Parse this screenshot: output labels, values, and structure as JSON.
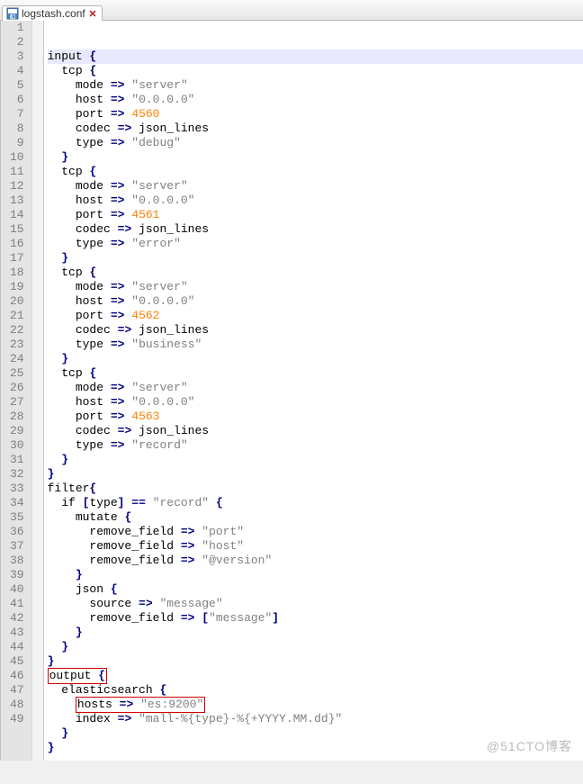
{
  "tab": {
    "filename": "logstash.conf",
    "icon": "disk-icon"
  },
  "lines": [
    {
      "n": 1,
      "indent": 0,
      "type": "open",
      "current": true,
      "tokens": [
        {
          "t": "input ",
          "c": "kw"
        },
        {
          "t": "{",
          "c": "sym"
        }
      ]
    },
    {
      "n": 2,
      "indent": 1,
      "type": "open",
      "tokens": [
        {
          "t": "tcp ",
          "c": "kw"
        },
        {
          "t": "{",
          "c": "sym"
        }
      ]
    },
    {
      "n": 3,
      "indent": 2,
      "tokens": [
        {
          "t": "mode ",
          "c": "kw"
        },
        {
          "t": "=>",
          "c": "sym"
        },
        {
          "t": " ",
          "c": "kw"
        },
        {
          "t": "\"server\"",
          "c": "str"
        }
      ]
    },
    {
      "n": 4,
      "indent": 2,
      "tokens": [
        {
          "t": "host ",
          "c": "kw"
        },
        {
          "t": "=>",
          "c": "sym"
        },
        {
          "t": " ",
          "c": "kw"
        },
        {
          "t": "\"0.0.0.0\"",
          "c": "str"
        }
      ]
    },
    {
      "n": 5,
      "indent": 2,
      "tokens": [
        {
          "t": "port ",
          "c": "kw"
        },
        {
          "t": "=>",
          "c": "sym"
        },
        {
          "t": " ",
          "c": "kw"
        },
        {
          "t": "4560",
          "c": "num"
        }
      ]
    },
    {
      "n": 6,
      "indent": 2,
      "tokens": [
        {
          "t": "codec ",
          "c": "kw"
        },
        {
          "t": "=>",
          "c": "sym"
        },
        {
          "t": " json_lines",
          "c": "kw"
        }
      ]
    },
    {
      "n": 7,
      "indent": 2,
      "tokens": [
        {
          "t": "type ",
          "c": "kw"
        },
        {
          "t": "=>",
          "c": "sym"
        },
        {
          "t": " ",
          "c": "kw"
        },
        {
          "t": "\"debug\"",
          "c": "str"
        }
      ]
    },
    {
      "n": 8,
      "indent": 1,
      "type": "close",
      "tokens": [
        {
          "t": "}",
          "c": "sym"
        }
      ]
    },
    {
      "n": 9,
      "indent": 1,
      "type": "open",
      "tokens": [
        {
          "t": "tcp ",
          "c": "kw"
        },
        {
          "t": "{",
          "c": "sym"
        }
      ]
    },
    {
      "n": 10,
      "indent": 2,
      "tokens": [
        {
          "t": "mode ",
          "c": "kw"
        },
        {
          "t": "=>",
          "c": "sym"
        },
        {
          "t": " ",
          "c": "kw"
        },
        {
          "t": "\"server\"",
          "c": "str"
        }
      ]
    },
    {
      "n": 11,
      "indent": 2,
      "tokens": [
        {
          "t": "host ",
          "c": "kw"
        },
        {
          "t": "=>",
          "c": "sym"
        },
        {
          "t": " ",
          "c": "kw"
        },
        {
          "t": "\"0.0.0.0\"",
          "c": "str"
        }
      ]
    },
    {
      "n": 12,
      "indent": 2,
      "tokens": [
        {
          "t": "port ",
          "c": "kw"
        },
        {
          "t": "=>",
          "c": "sym"
        },
        {
          "t": " ",
          "c": "kw"
        },
        {
          "t": "4561",
          "c": "num"
        }
      ]
    },
    {
      "n": 13,
      "indent": 2,
      "tokens": [
        {
          "t": "codec ",
          "c": "kw"
        },
        {
          "t": "=>",
          "c": "sym"
        },
        {
          "t": " json_lines",
          "c": "kw"
        }
      ]
    },
    {
      "n": 14,
      "indent": 2,
      "tokens": [
        {
          "t": "type ",
          "c": "kw"
        },
        {
          "t": "=>",
          "c": "sym"
        },
        {
          "t": " ",
          "c": "kw"
        },
        {
          "t": "\"error\"",
          "c": "str"
        }
      ]
    },
    {
      "n": 15,
      "indent": 1,
      "type": "close",
      "tokens": [
        {
          "t": "}",
          "c": "sym"
        }
      ]
    },
    {
      "n": 16,
      "indent": 1,
      "type": "open",
      "tokens": [
        {
          "t": "tcp ",
          "c": "kw"
        },
        {
          "t": "{",
          "c": "sym"
        }
      ]
    },
    {
      "n": 17,
      "indent": 2,
      "tokens": [
        {
          "t": "mode ",
          "c": "kw"
        },
        {
          "t": "=>",
          "c": "sym"
        },
        {
          "t": " ",
          "c": "kw"
        },
        {
          "t": "\"server\"",
          "c": "str"
        }
      ]
    },
    {
      "n": 18,
      "indent": 2,
      "tokens": [
        {
          "t": "host ",
          "c": "kw"
        },
        {
          "t": "=>",
          "c": "sym"
        },
        {
          "t": " ",
          "c": "kw"
        },
        {
          "t": "\"0.0.0.0\"",
          "c": "str"
        }
      ]
    },
    {
      "n": 19,
      "indent": 2,
      "tokens": [
        {
          "t": "port ",
          "c": "kw"
        },
        {
          "t": "=>",
          "c": "sym"
        },
        {
          "t": " ",
          "c": "kw"
        },
        {
          "t": "4562",
          "c": "num"
        }
      ]
    },
    {
      "n": 20,
      "indent": 2,
      "tokens": [
        {
          "t": "codec ",
          "c": "kw"
        },
        {
          "t": "=>",
          "c": "sym"
        },
        {
          "t": " json_lines",
          "c": "kw"
        }
      ]
    },
    {
      "n": 21,
      "indent": 2,
      "tokens": [
        {
          "t": "type ",
          "c": "kw"
        },
        {
          "t": "=>",
          "c": "sym"
        },
        {
          "t": " ",
          "c": "kw"
        },
        {
          "t": "\"business\"",
          "c": "str"
        }
      ]
    },
    {
      "n": 22,
      "indent": 1,
      "type": "close",
      "tokens": [
        {
          "t": "}",
          "c": "sym"
        }
      ]
    },
    {
      "n": 23,
      "indent": 1,
      "type": "open",
      "tokens": [
        {
          "t": "tcp ",
          "c": "kw"
        },
        {
          "t": "{",
          "c": "sym"
        }
      ]
    },
    {
      "n": 24,
      "indent": 2,
      "tokens": [
        {
          "t": "mode ",
          "c": "kw"
        },
        {
          "t": "=>",
          "c": "sym"
        },
        {
          "t": " ",
          "c": "kw"
        },
        {
          "t": "\"server\"",
          "c": "str"
        }
      ]
    },
    {
      "n": 25,
      "indent": 2,
      "tokens": [
        {
          "t": "host ",
          "c": "kw"
        },
        {
          "t": "=>",
          "c": "sym"
        },
        {
          "t": " ",
          "c": "kw"
        },
        {
          "t": "\"0.0.0.0\"",
          "c": "str"
        }
      ]
    },
    {
      "n": 26,
      "indent": 2,
      "tokens": [
        {
          "t": "port ",
          "c": "kw"
        },
        {
          "t": "=>",
          "c": "sym"
        },
        {
          "t": " ",
          "c": "kw"
        },
        {
          "t": "4563",
          "c": "num"
        }
      ]
    },
    {
      "n": 27,
      "indent": 2,
      "tokens": [
        {
          "t": "codec ",
          "c": "kw"
        },
        {
          "t": "=>",
          "c": "sym"
        },
        {
          "t": " json_lines",
          "c": "kw"
        }
      ]
    },
    {
      "n": 28,
      "indent": 2,
      "tokens": [
        {
          "t": "type ",
          "c": "kw"
        },
        {
          "t": "=>",
          "c": "sym"
        },
        {
          "t": " ",
          "c": "kw"
        },
        {
          "t": "\"record\"",
          "c": "str"
        }
      ]
    },
    {
      "n": 29,
      "indent": 1,
      "type": "close",
      "tokens": [
        {
          "t": "}",
          "c": "sym"
        }
      ]
    },
    {
      "n": 30,
      "indent": 0,
      "type": "close",
      "tokens": [
        {
          "t": "}",
          "c": "sym"
        }
      ]
    },
    {
      "n": 31,
      "indent": 0,
      "type": "open",
      "tokens": [
        {
          "t": "filter",
          "c": "kw"
        },
        {
          "t": "{",
          "c": "sym"
        }
      ]
    },
    {
      "n": 32,
      "indent": 1,
      "type": "open",
      "tokens": [
        {
          "t": "if ",
          "c": "kw"
        },
        {
          "t": "[",
          "c": "sym"
        },
        {
          "t": "type",
          "c": "kw"
        },
        {
          "t": "]",
          "c": "sym"
        },
        {
          "t": " ",
          "c": "kw"
        },
        {
          "t": "==",
          "c": "sym"
        },
        {
          "t": " ",
          "c": "kw"
        },
        {
          "t": "\"record\"",
          "c": "str"
        },
        {
          "t": " ",
          "c": "kw"
        },
        {
          "t": "{",
          "c": "sym"
        }
      ]
    },
    {
      "n": 33,
      "indent": 2,
      "type": "open",
      "tokens": [
        {
          "t": "mutate ",
          "c": "kw"
        },
        {
          "t": "{",
          "c": "sym"
        }
      ]
    },
    {
      "n": 34,
      "indent": 3,
      "tokens": [
        {
          "t": "remove_field ",
          "c": "kw"
        },
        {
          "t": "=>",
          "c": "sym"
        },
        {
          "t": " ",
          "c": "kw"
        },
        {
          "t": "\"port\"",
          "c": "str"
        }
      ]
    },
    {
      "n": 35,
      "indent": 3,
      "tokens": [
        {
          "t": "remove_field ",
          "c": "kw"
        },
        {
          "t": "=>",
          "c": "sym"
        },
        {
          "t": " ",
          "c": "kw"
        },
        {
          "t": "\"host\"",
          "c": "str"
        }
      ]
    },
    {
      "n": 36,
      "indent": 3,
      "tokens": [
        {
          "t": "remove_field ",
          "c": "kw"
        },
        {
          "t": "=>",
          "c": "sym"
        },
        {
          "t": " ",
          "c": "kw"
        },
        {
          "t": "\"@version\"",
          "c": "str"
        }
      ]
    },
    {
      "n": 37,
      "indent": 2,
      "type": "close",
      "tokens": [
        {
          "t": "}",
          "c": "sym"
        }
      ]
    },
    {
      "n": 38,
      "indent": 2,
      "type": "open",
      "tokens": [
        {
          "t": "json ",
          "c": "kw"
        },
        {
          "t": "{",
          "c": "sym"
        }
      ]
    },
    {
      "n": 39,
      "indent": 3,
      "tokens": [
        {
          "t": "source ",
          "c": "kw"
        },
        {
          "t": "=>",
          "c": "sym"
        },
        {
          "t": " ",
          "c": "kw"
        },
        {
          "t": "\"message\"",
          "c": "str"
        }
      ]
    },
    {
      "n": 40,
      "indent": 3,
      "tokens": [
        {
          "t": "remove_field ",
          "c": "kw"
        },
        {
          "t": "=>",
          "c": "sym"
        },
        {
          "t": " ",
          "c": "kw"
        },
        {
          "t": "[",
          "c": "sym"
        },
        {
          "t": "\"message\"",
          "c": "str"
        },
        {
          "t": "]",
          "c": "sym"
        }
      ]
    },
    {
      "n": 41,
      "indent": 2,
      "type": "close",
      "tokens": [
        {
          "t": "}",
          "c": "sym"
        }
      ]
    },
    {
      "n": 42,
      "indent": 1,
      "type": "close",
      "tokens": [
        {
          "t": "}",
          "c": "sym"
        }
      ]
    },
    {
      "n": 43,
      "indent": 0,
      "type": "close",
      "tokens": [
        {
          "t": "}",
          "c": "sym"
        }
      ]
    },
    {
      "n": 44,
      "indent": 0,
      "type": "open",
      "hl": "outer",
      "tokens": [
        {
          "t": "output ",
          "c": "kw"
        },
        {
          "t": "{",
          "c": "sym"
        }
      ]
    },
    {
      "n": 45,
      "indent": 1,
      "type": "open",
      "tokens": [
        {
          "t": "elasticsearch ",
          "c": "kw"
        },
        {
          "t": "{",
          "c": "sym"
        }
      ]
    },
    {
      "n": 46,
      "indent": 2,
      "hl": "inner",
      "tokens": [
        {
          "t": "hosts ",
          "c": "kw"
        },
        {
          "t": "=>",
          "c": "sym"
        },
        {
          "t": " ",
          "c": "kw"
        },
        {
          "t": "\"es:9200\"",
          "c": "str"
        }
      ]
    },
    {
      "n": 47,
      "indent": 2,
      "tokens": [
        {
          "t": "index ",
          "c": "kw"
        },
        {
          "t": "=>",
          "c": "sym"
        },
        {
          "t": " ",
          "c": "kw"
        },
        {
          "t": "\"mall-%{type}-%{+YYYY.MM.dd}\"",
          "c": "str"
        }
      ]
    },
    {
      "n": 48,
      "indent": 1,
      "type": "close",
      "tokens": [
        {
          "t": "}",
          "c": "sym"
        }
      ]
    },
    {
      "n": 49,
      "indent": 0,
      "type": "close",
      "tokens": [
        {
          "t": "}",
          "c": "sym"
        }
      ]
    }
  ],
  "watermark": "@51CTO博客"
}
